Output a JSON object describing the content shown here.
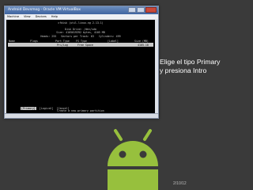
{
  "window": {
    "title": "Android Devsmog - Oracle VM VirtualBox",
    "menu": [
      "Machine",
      "View",
      "Devices",
      "Help"
    ]
  },
  "terminal": {
    "version_line": "cfdisk (util-linux-ng 2.13.1)",
    "disk_drive": "Disk Drive: /dev/sda",
    "size_line": "Size: 4105019392 bytes, 4105 MB",
    "geometry_line": "Heads: 255   Sectors per Track: 63   Cylinders: 499",
    "columns": [
      "Name",
      "Flags",
      "Part Type",
      "FS Type",
      "[Label]",
      "Size (MB)"
    ],
    "selected_row": {
      "part_type": "Pri/Log",
      "fs_type": "Free Space",
      "size": "4105.10"
    },
    "options": [
      "[Primary]",
      "[Logical]",
      "[Cancel]"
    ],
    "hint": "Create a new primary partition"
  },
  "caption": {
    "line1": "Elige el tipo Primary",
    "line2": "y presiona Intro"
  },
  "page_number": "2/10/12"
}
